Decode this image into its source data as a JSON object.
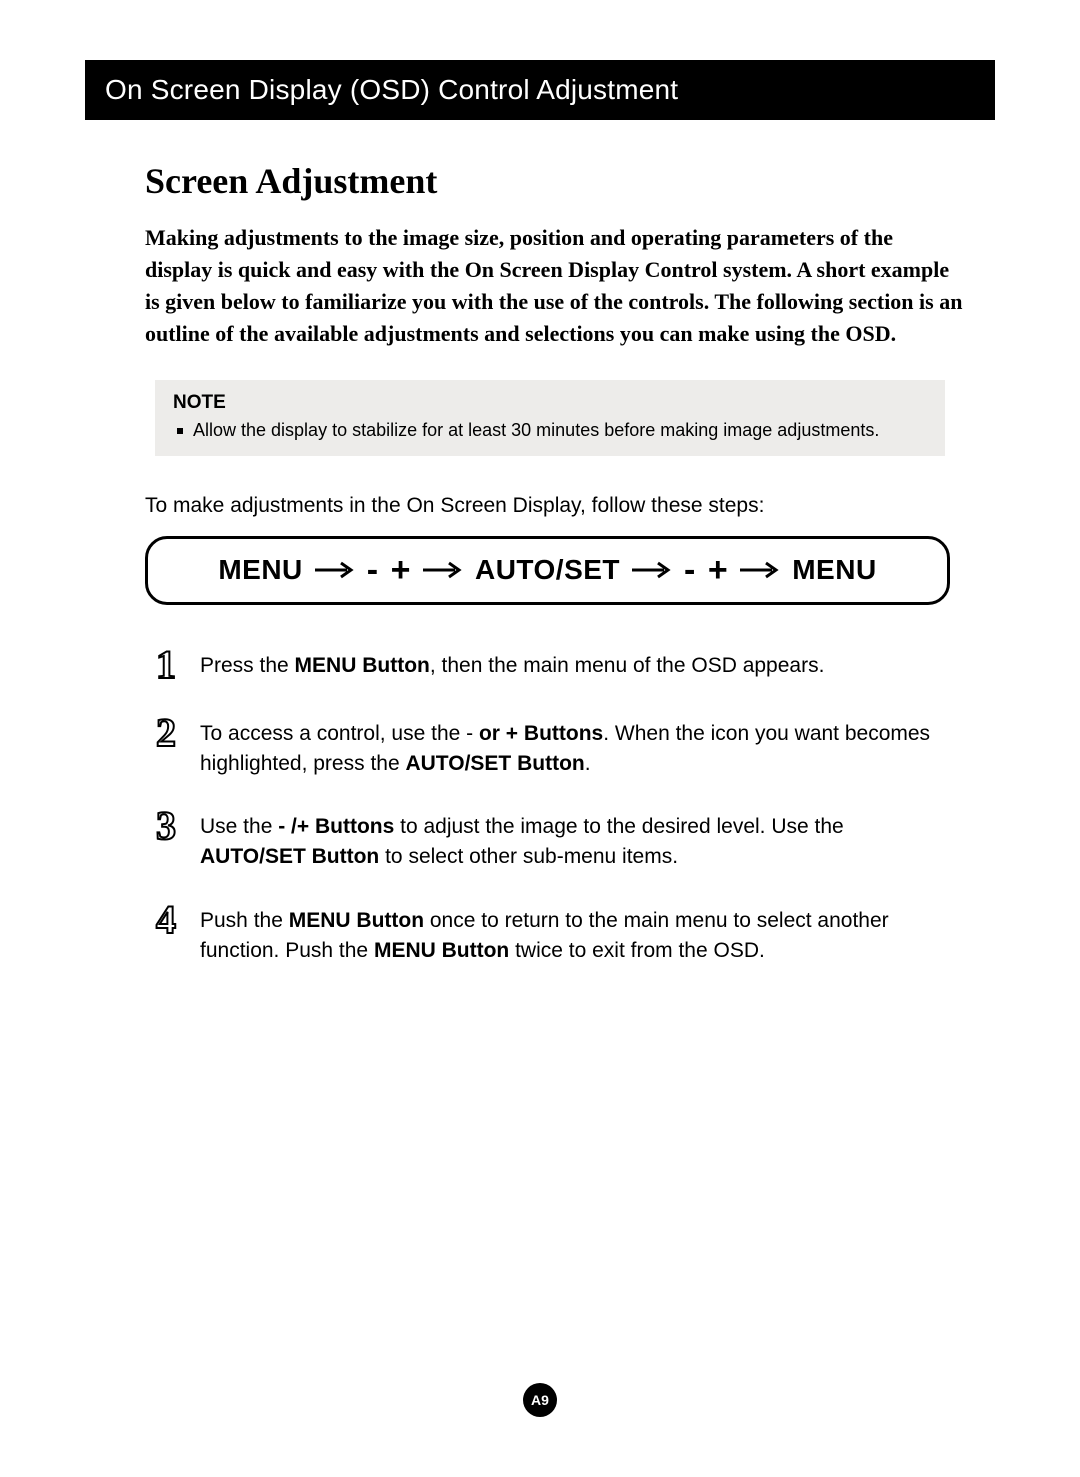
{
  "header": {
    "title": "On Screen Display (OSD) Control Adjustment"
  },
  "sectionTitle": "Screen Adjustment",
  "intro": "Making adjustments to the image size, position and operating parameters of the display is quick and easy with the On Screen Display Control system. A short example is given below to familiarize you with the use of the controls. The following section is an outline of the available adjustments and selections you can make using the OSD.",
  "note": {
    "label": "NOTE",
    "items": [
      "Allow the display to stabilize for at least 30 minutes before making image adjustments."
    ]
  },
  "lead": "To make adjustments in the On Screen Display, follow these steps:",
  "flow": {
    "seq": [
      "MENU",
      "→",
      "-",
      "+",
      "→",
      "AUTO/SET",
      "→",
      "-",
      "+",
      "→",
      "MENU"
    ]
  },
  "steps": [
    {
      "n": "1",
      "pre": "Press the ",
      "b1": "MENU Button",
      "post": ", then the main menu of the OSD appears."
    },
    {
      "n": "2",
      "pre": "To access a control, use the - ",
      "b1": "or + Buttons",
      "mid": ". When the icon you want becomes highlighted, press the ",
      "b2": "AUTO/SET Button",
      "post": "."
    },
    {
      "n": "3",
      "pre": " Use the  ",
      "b1": "- /+ Buttons",
      "mid": " to adjust the image to the desired level. Use the ",
      "b2": "AUTO/SET Button",
      "post": " to select other sub-menu items."
    },
    {
      "n": "4",
      "pre": "Push the ",
      "b1": "MENU Button",
      "mid": " once to return to the main menu to select another function. Push the ",
      "b2": "MENU Button",
      "post": " twice to exit from the OSD."
    }
  ],
  "pageNumber": "A9"
}
